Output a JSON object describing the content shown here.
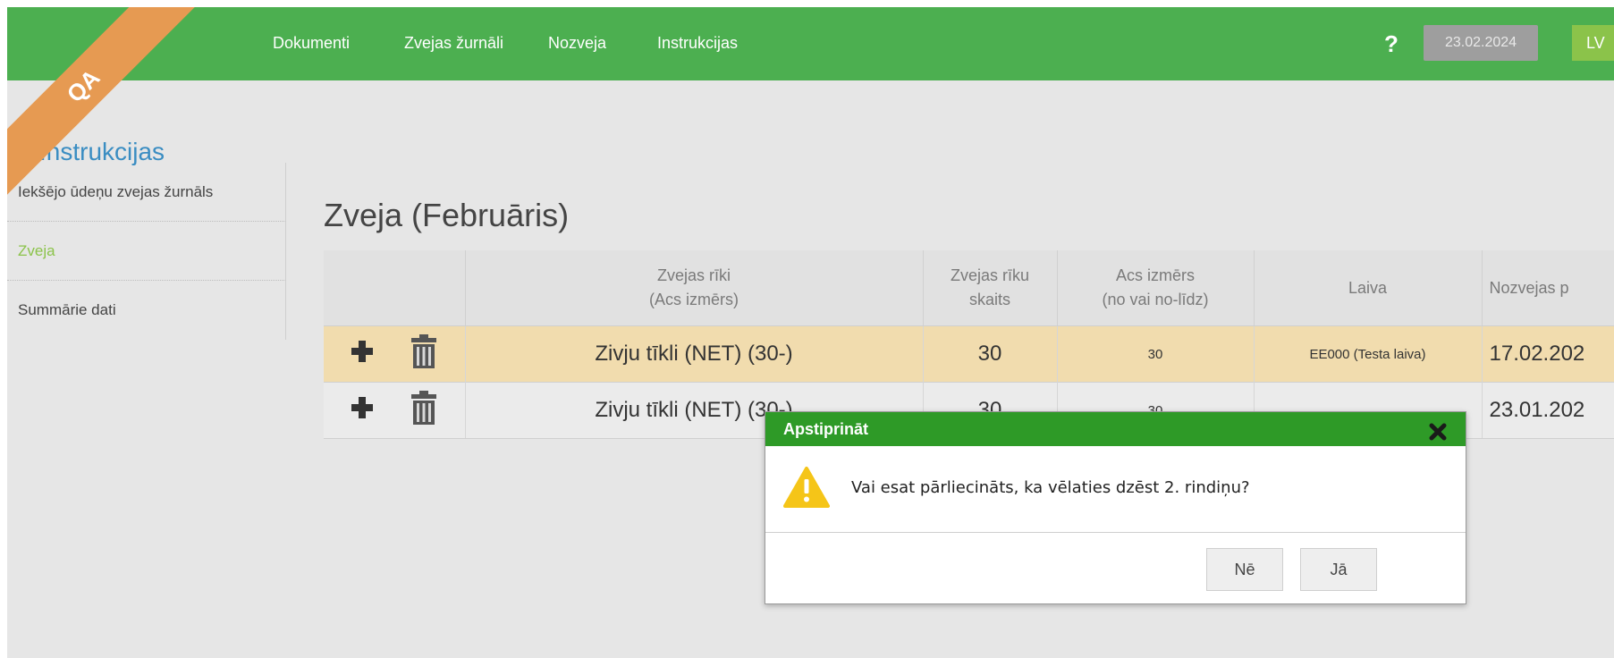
{
  "environment_badge": "QA",
  "nav": {
    "links": [
      "Dokumenti",
      "Zvejas žurnāli",
      "Nozveja",
      "Instrukcijas"
    ],
    "help": "?",
    "date": "23.02.2024",
    "language": "LV"
  },
  "sidebar": {
    "heading": "Instrukcijas",
    "items": [
      {
        "label": "Iekšējo ūdeņu zvejas žurnāls",
        "active": false
      },
      {
        "label": "Zveja",
        "active": true
      },
      {
        "label": "Summārie dati",
        "active": false
      }
    ]
  },
  "page": {
    "title": "Zveja (Februāris)"
  },
  "table": {
    "headers": [
      "",
      "Zvejas rīki\n(Acs izmērs)",
      "Zvejas rīku\nskaits",
      "Acs izmērs\n(no vai no-līdz)",
      "Laiva",
      "Nozvejas p"
    ],
    "rows": [
      {
        "gear": "Zivju tīkli (NET) (30-)",
        "count": "30",
        "mesh": "30",
        "boat": "EE000 (Testa laiva)",
        "date": "17.02.202",
        "highlighted": true
      },
      {
        "gear": "Zivju tīkli (NET) (30-)",
        "count": "30",
        "mesh": "30",
        "boat": "",
        "date": "23.01.202",
        "highlighted": false
      }
    ]
  },
  "dialog": {
    "title": "Apstiprināt",
    "message": "Vai esat pārliecināts, ka vēlaties dzēst 2. rindiņu?",
    "no_label": "Nē",
    "yes_label": "Jā"
  },
  "colors": {
    "nav_bg": "#4caf50",
    "dialog_header": "#2e9a27",
    "row_highlight": "#f1dcae",
    "sidebar_active": "#8bc34a",
    "ribbon": "#e69a52"
  }
}
